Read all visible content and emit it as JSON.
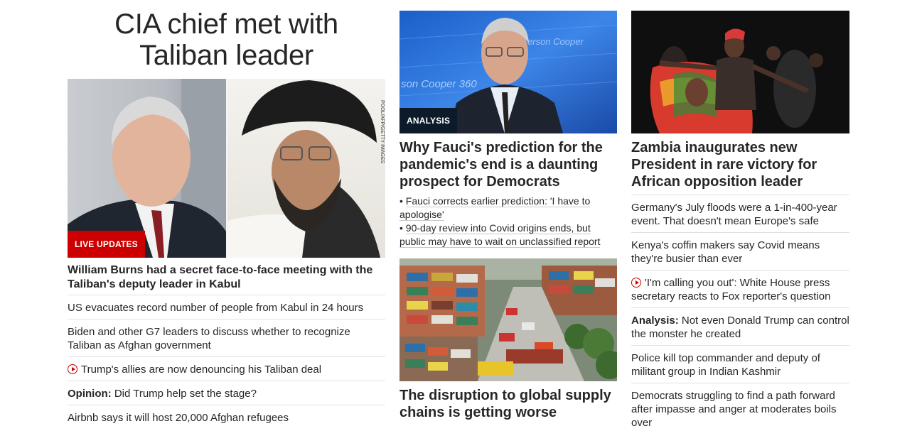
{
  "col1": {
    "headline": "CIA chief met with Taliban leader",
    "image_credit": "POOL/AFP/GETTY IMAGES",
    "label": "LIVE UPDATES",
    "title": "William Burns had a secret face-to-face meeting with the Taliban's deputy leader in Kabul",
    "links": [
      {
        "prefix": "",
        "text": "US evacuates record number of people from Kabul in 24 hours"
      },
      {
        "prefix": "",
        "text": "Biden and other G7 leaders to discuss whether to recognize Taliban as Afghan government"
      },
      {
        "prefix": "",
        "text": "Trump's allies are now denouncing his Taliban deal",
        "icon": "play-icon"
      },
      {
        "prefix": "Opinion:",
        "text": "Did Trump help set the stage?"
      },
      {
        "prefix": "",
        "text": "Airbnb says it will host 20,000 Afghan refugees"
      }
    ]
  },
  "col2": {
    "label": "ANALYSIS",
    "title": "Why Fauci's prediction for the pandemic's end is a daunting prospect for Democrats",
    "bullets": [
      "Fauci corrects earlier prediction: 'I have to apologise'",
      "90-day review into Covid origins ends, but public may have to wait on unclassified report"
    ],
    "studio_text_1": "erson Cooper",
    "studio_text_2": "son Cooper 360",
    "title2": "The disruption to global supply chains is getting worse"
  },
  "col3": {
    "title": "Zambia inaugurates new President in rare victory for African opposition leader",
    "links": [
      {
        "prefix": "",
        "text": "Germany's July floods were a 1-in-400-year event. That doesn't mean Europe's safe"
      },
      {
        "prefix": "",
        "text": "Kenya's coffin makers say Covid means they're busier than ever"
      },
      {
        "prefix": "",
        "text": "'I'm calling you out': White House press secretary reacts to Fox reporter's question",
        "icon": "play-icon"
      },
      {
        "prefix": "Analysis:",
        "text": "Not even Donald Trump can control the monster he created"
      },
      {
        "prefix": "",
        "text": "Police kill top commander and deputy of militant group in Indian Kashmir"
      },
      {
        "prefix": "",
        "text": "Democrats struggling to find a path forward after impasse and anger at moderates boils over"
      }
    ]
  },
  "colors": {
    "live_red": "#cc0000",
    "analysis_navy": "#0c1a2a",
    "text": "#262626",
    "divider": "#e0e0e0"
  }
}
